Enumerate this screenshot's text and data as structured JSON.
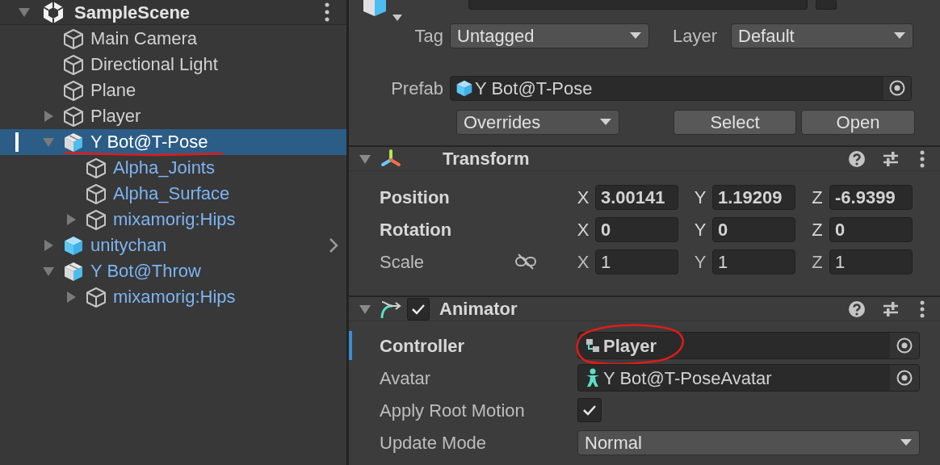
{
  "hierarchy": {
    "title": "SampleScene",
    "expanded": true,
    "items": [
      {
        "label": "Main Camera",
        "kind": "object",
        "linked": false,
        "selected": false
      },
      {
        "label": "Directional Light",
        "kind": "object",
        "linked": false,
        "selected": false
      },
      {
        "label": "Plane",
        "kind": "object",
        "linked": false,
        "selected": false
      },
      {
        "label": "Player",
        "kind": "object",
        "linked": false,
        "selected": false,
        "expanded": false
      },
      {
        "label": "Y Bot@T-Pose",
        "kind": "model",
        "linked": true,
        "selected": true,
        "expanded": true,
        "underlined": true,
        "children": [
          {
            "label": "Alpha_Joints",
            "kind": "object",
            "linked": true,
            "selected": false
          },
          {
            "label": "Alpha_Surface",
            "kind": "object",
            "linked": true,
            "selected": false
          },
          {
            "label": "mixamorig:Hips",
            "kind": "object",
            "linked": true,
            "selected": false,
            "expanded": false
          }
        ]
      },
      {
        "label": "unitychan",
        "kind": "prefab",
        "linked": true,
        "selected": false,
        "expanded": false,
        "submenu": true
      },
      {
        "label": "Y Bot@Throw",
        "kind": "model",
        "linked": true,
        "selected": false,
        "expanded": true,
        "children": [
          {
            "label": "mixamorig:Hips",
            "kind": "object",
            "linked": true,
            "selected": false,
            "expanded": false
          }
        ]
      }
    ]
  },
  "inspector": {
    "static_checked": false,
    "tag": {
      "label": "Tag",
      "value": "Untagged"
    },
    "layer": {
      "label": "Layer",
      "value": "Default"
    },
    "prefab": {
      "label": "Prefab",
      "value": "Y Bot@T-Pose"
    },
    "prefab_buttons": [
      {
        "label": "Overrides",
        "kind": "dropdown"
      },
      {
        "label": "Select",
        "kind": "button"
      },
      {
        "label": "Open",
        "kind": "button"
      }
    ],
    "components": [
      {
        "title": "Transform",
        "kind": "transform",
        "expanded": true,
        "rows": [
          {
            "label": "Position",
            "overridden": true,
            "fields": [
              {
                "axis": "X",
                "value": "3.00141"
              },
              {
                "axis": "Y",
                "value": "1.19209"
              },
              {
                "axis": "Z",
                "value": "-6.9399"
              }
            ]
          },
          {
            "label": "Rotation",
            "overridden": true,
            "fields": [
              {
                "axis": "X",
                "value": "0"
              },
              {
                "axis": "Y",
                "value": "0"
              },
              {
                "axis": "Z",
                "value": "0"
              }
            ]
          },
          {
            "label": "Scale",
            "overridden": false,
            "constrained": false,
            "fields": [
              {
                "axis": "X",
                "value": "1"
              },
              {
                "axis": "Y",
                "value": "1"
              },
              {
                "axis": "Z",
                "value": "1"
              }
            ]
          }
        ]
      },
      {
        "title": "Animator",
        "kind": "animator",
        "expanded": true,
        "enabled": true,
        "rows": [
          {
            "label": "Controller",
            "kind": "controller",
            "overridden": true,
            "focused": true,
            "value": "Player",
            "circled": true
          },
          {
            "label": "Avatar",
            "kind": "avatar",
            "overridden": false,
            "focused": false,
            "value": "Y Bot@T-PoseAvatar"
          },
          {
            "label": "Apply Root Motion",
            "kind": "checkbox",
            "overridden": false,
            "focused": false,
            "checked": true
          },
          {
            "label": "Update Mode",
            "kind": "dropdown",
            "overridden": false,
            "focused": false,
            "value": "Normal"
          }
        ]
      }
    ]
  }
}
